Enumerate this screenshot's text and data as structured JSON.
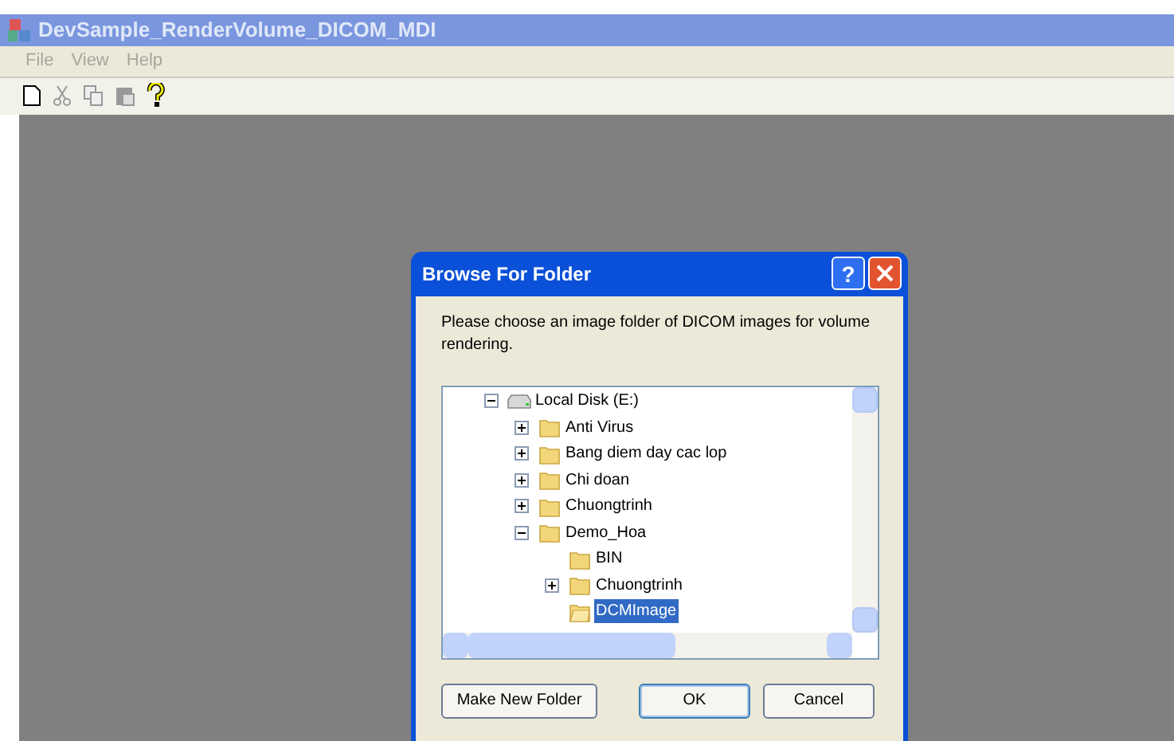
{
  "window": {
    "title": "DevSample_RenderVolume_DICOM_MDI"
  },
  "menu": [
    "File",
    "View",
    "Help"
  ],
  "dialog": {
    "title": "Browse For Folder",
    "help_button": "?",
    "message": "Please choose an image folder of DICOM images for volume rendering.",
    "tree": [
      {
        "label": "Local Disk (E:)",
        "kind": "drive",
        "expanded": true,
        "selected": false,
        "children": [
          {
            "label": "Anti Virus",
            "kind": "folder",
            "expanded": false,
            "selected": false
          },
          {
            "label": "Bang diem day cac lop",
            "kind": "folder",
            "expanded": false,
            "selected": false
          },
          {
            "label": "Chi doan",
            "kind": "folder",
            "expanded": false,
            "selected": false
          },
          {
            "label": "Chuongtrinh",
            "kind": "folder",
            "expanded": false,
            "selected": false
          },
          {
            "label": "Demo_Hoa",
            "kind": "folder",
            "expanded": true,
            "selected": false,
            "children": [
              {
                "label": "BIN",
                "kind": "folder",
                "selected": false
              },
              {
                "label": "Chuongtrinh",
                "kind": "folder",
                "expanded": false,
                "selected": false
              },
              {
                "label": "DCMImage",
                "kind": "folder",
                "selected": true
              }
            ]
          }
        ]
      }
    ],
    "buttons": [
      {
        "label": "Make New Folder",
        "kind": "secondary"
      },
      {
        "label": "OK",
        "kind": "default"
      },
      {
        "label": "Cancel",
        "kind": "secondary"
      }
    ]
  }
}
